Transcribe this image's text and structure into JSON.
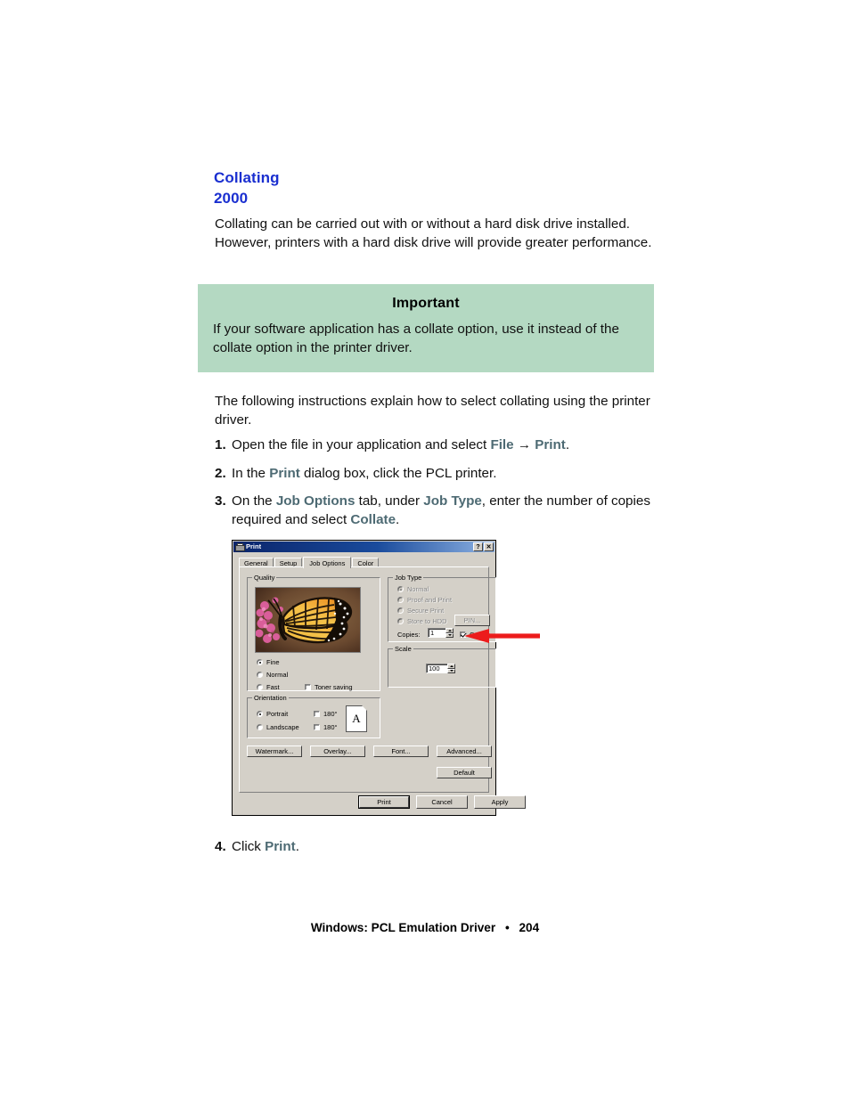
{
  "heading": {
    "line1": "Collating",
    "line2": "2000"
  },
  "intro": "Collating can be carried out with or without a hard disk drive installed. However, printers with a hard disk drive will provide greater performance.",
  "important": {
    "title": "Important",
    "body": "If your software application has a collate option, use it instead of the collate option in the printer driver.",
    "bg_color": "#b4d9c2"
  },
  "lead": "The following instructions explain how to select collating using the printer driver.",
  "steps": [
    {
      "num": "1.",
      "pre": "Open the file in your application and select ",
      "em1": "File",
      "mid": " → ",
      "em2": "Print",
      "post": "."
    },
    {
      "num": "2.",
      "pre": "In the ",
      "em1": "Print",
      "mid": " dialog box, click the PCL printer.",
      "em2": "",
      "post": ""
    },
    {
      "num": "3.",
      "pre": "On the ",
      "em1": "Job Options",
      "mid": " tab, under ",
      "em2": "Job Type",
      "post": ", enter the number of copies required and select ",
      "em3": "Collate",
      "post2": "."
    }
  ],
  "step4": {
    "num": "4.",
    "pre": "Click ",
    "em": "Print",
    "post": "."
  },
  "footer": {
    "text": "Windows: PCL Emulation Driver",
    "bullet": "•",
    "page": "204"
  },
  "colors": {
    "heading_blue": "#1a2fd0",
    "emphasis": "#4d6a73",
    "arrow_red": "#ec1c1c",
    "dialog_face": "#d4d0c8"
  },
  "dialog": {
    "title": "Print",
    "titlebar_buttons": {
      "help": "?",
      "close": "✕"
    },
    "tabs": [
      {
        "label": "General",
        "active": false
      },
      {
        "label": "Setup",
        "active": false
      },
      {
        "label": "Job Options",
        "active": true
      },
      {
        "label": "Color",
        "active": false
      }
    ],
    "quality": {
      "group_label": "Quality",
      "options": [
        {
          "label": "Fine",
          "selected": true
        },
        {
          "label": "Normal",
          "selected": false
        },
        {
          "label": "Fast",
          "selected": false
        }
      ],
      "toner_saving": {
        "label": "Toner saving",
        "checked": false
      }
    },
    "job_type": {
      "group_label": "Job Type",
      "options": [
        {
          "label": "Normal",
          "selected": true,
          "disabled": true
        },
        {
          "label": "Proof and Print",
          "selected": false,
          "disabled": true
        },
        {
          "label": "Secure Print",
          "selected": false,
          "disabled": true
        },
        {
          "label": "Store to HDD",
          "selected": false,
          "disabled": true
        }
      ],
      "pin_button": "PIN...",
      "copies_label": "Copies:",
      "copies_value": "1",
      "collate": {
        "label": "Collate",
        "checked": true
      }
    },
    "scale": {
      "group_label": "Scale",
      "value": "100"
    },
    "orientation": {
      "group_label": "Orientation",
      "options": [
        {
          "label": "Portrait",
          "selected": true
        },
        {
          "label": "Landscape",
          "selected": false
        }
      ],
      "rotate": [
        {
          "label": "180°",
          "checked": false
        },
        {
          "label": "180°",
          "checked": false
        }
      ],
      "page_glyph": "A"
    },
    "buttons": {
      "watermark": "Watermark...",
      "overlay": "Overlay...",
      "font": "Font...",
      "advanced": "Advanced...",
      "default": "Default",
      "print": "Print",
      "cancel": "Cancel",
      "apply": "Apply"
    }
  }
}
